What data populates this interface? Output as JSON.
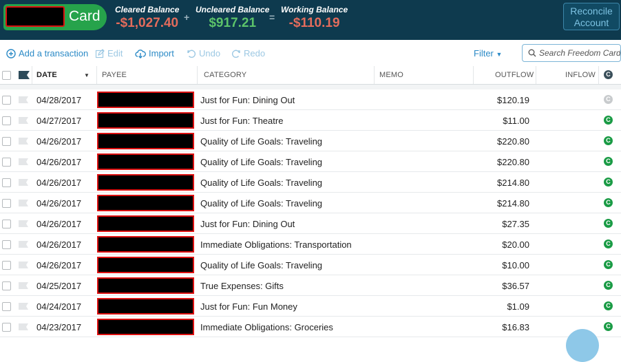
{
  "header": {
    "account_name": "Card",
    "cleared": {
      "label": "Cleared Balance",
      "amount": "-$1,027.40"
    },
    "plus": "+",
    "uncleared": {
      "label": "Uncleared Balance",
      "amount": "$917.21"
    },
    "equals": "=",
    "working": {
      "label": "Working Balance",
      "amount": "-$110.19"
    },
    "reconcile_label": "Reconcile Account"
  },
  "toolbar": {
    "add": "Add a transaction",
    "edit": "Edit",
    "import": "Import",
    "undo": "Undo",
    "redo": "Redo",
    "filter": "Filter",
    "search_placeholder": "Search Freedom Card"
  },
  "columns": {
    "date": "DATE",
    "payee": "PAYEE",
    "category": "CATEGORY",
    "memo": "MEMO",
    "outflow": "OUTFLOW",
    "inflow": "INFLOW"
  },
  "transactions": [
    {
      "date": "04/28/2017",
      "category": "Just for Fun: Dining Out",
      "outflow": "$120.19",
      "cleared": false
    },
    {
      "date": "04/27/2017",
      "category": "Just for Fun: Theatre",
      "outflow": "$11.00",
      "cleared": true
    },
    {
      "date": "04/26/2017",
      "category": "Quality of Life Goals: Traveling",
      "outflow": "$220.80",
      "cleared": true
    },
    {
      "date": "04/26/2017",
      "category": "Quality of Life Goals: Traveling",
      "outflow": "$220.80",
      "cleared": true
    },
    {
      "date": "04/26/2017",
      "category": "Quality of Life Goals: Traveling",
      "outflow": "$214.80",
      "cleared": true
    },
    {
      "date": "04/26/2017",
      "category": "Quality of Life Goals: Traveling",
      "outflow": "$214.80",
      "cleared": true
    },
    {
      "date": "04/26/2017",
      "category": "Just for Fun: Dining Out",
      "outflow": "$27.35",
      "cleared": true
    },
    {
      "date": "04/26/2017",
      "category": "Immediate Obligations: Transportation",
      "outflow": "$20.00",
      "cleared": true
    },
    {
      "date": "04/26/2017",
      "category": "Quality of Life Goals: Traveling",
      "outflow": "$10.00",
      "cleared": true
    },
    {
      "date": "04/25/2017",
      "category": "True Expenses: Gifts",
      "outflow": "$36.57",
      "cleared": true
    },
    {
      "date": "04/24/2017",
      "category": "Just for Fun: Fun Money",
      "outflow": "$1.09",
      "cleared": true
    },
    {
      "date": "04/23/2017",
      "category": "Immediate Obligations: Groceries",
      "outflow": "$16.83",
      "cleared": true
    }
  ],
  "cleared_glyph": "C",
  "colors": {
    "header_bg": "#0e3a4e",
    "account_green": "#26a34b",
    "negative": "#e46c5c",
    "positive": "#5cc36a",
    "link_blue": "#2b8ac6",
    "cleared_green": "#1a9b45"
  }
}
